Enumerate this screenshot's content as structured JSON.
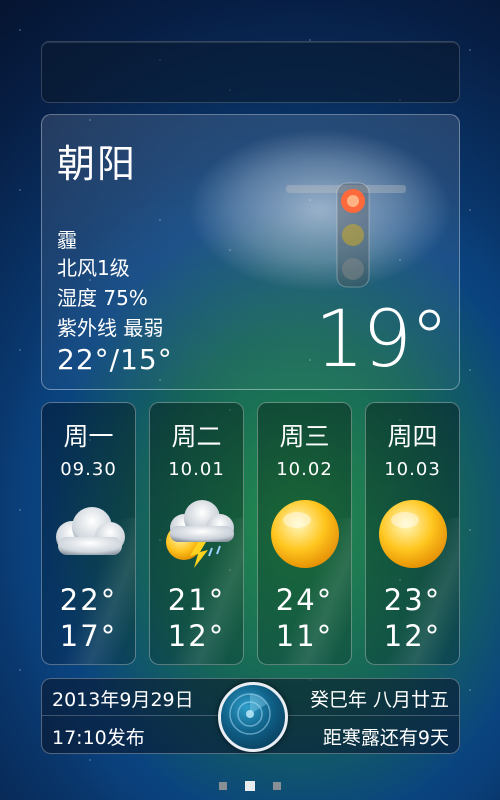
{
  "current": {
    "city": "朝阳",
    "condition": "霾",
    "wind": "北风1级",
    "humidity": "湿度 75%",
    "uv": "紫外线 最弱",
    "range": "22°/15°",
    "temperature": "19°"
  },
  "forecast": [
    {
      "day": "周一",
      "date": "09.30",
      "icon": "cloudy-icon",
      "high": "22°",
      "low": "17°"
    },
    {
      "day": "周二",
      "date": "10.01",
      "icon": "thunderstorm-sun-icon",
      "high": "21°",
      "low": "12°"
    },
    {
      "day": "周三",
      "date": "10.02",
      "icon": "sun-icon",
      "high": "24°",
      "low": "11°"
    },
    {
      "day": "周四",
      "date": "10.03",
      "icon": "sun-icon",
      "high": "23°",
      "low": "12°"
    }
  ],
  "footer": {
    "date": "2013年9月29日",
    "lunar": "癸巳年 八月廿五",
    "published": "17:10发布",
    "solar_term": "距寒露还有9天"
  },
  "pager": {
    "count": 3,
    "active_index": 2
  }
}
